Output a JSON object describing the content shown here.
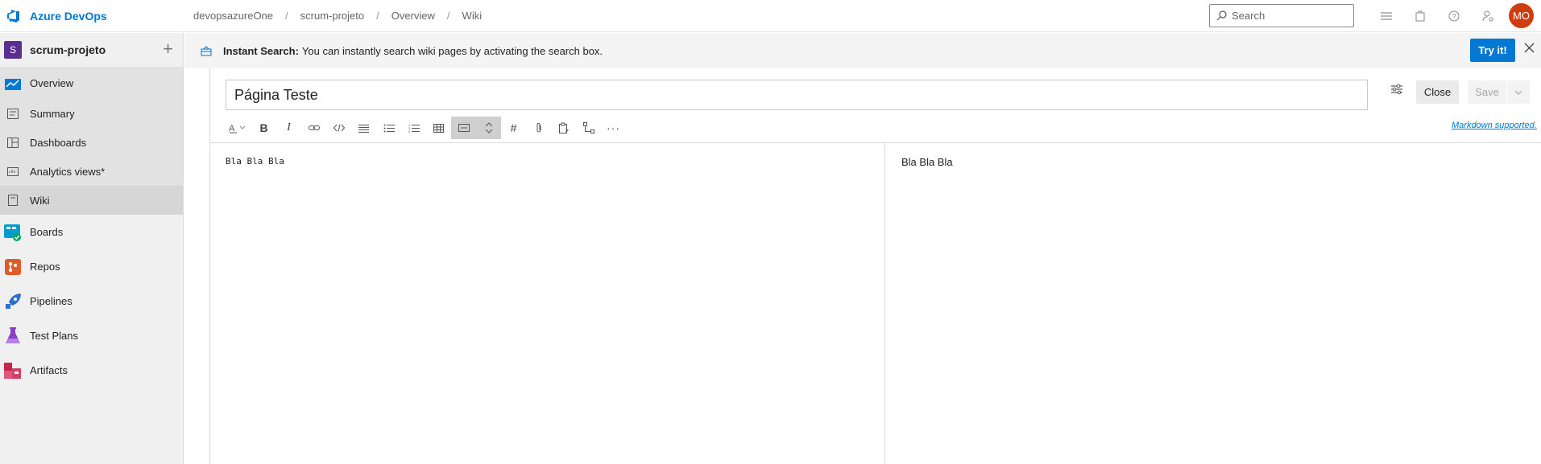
{
  "header": {
    "brand": "Azure DevOps",
    "breadcrumbs": [
      "devopsazureOne",
      "scrum-projeto",
      "Overview",
      "Wiki"
    ],
    "search_placeholder": "Search",
    "avatar_initials": "MO"
  },
  "sidebar": {
    "project_initial": "S",
    "project_name": "scrum-projeto",
    "items": [
      {
        "label": "Overview",
        "icon": "overview-icon"
      },
      {
        "label": "Summary",
        "icon": "summary-icon"
      },
      {
        "label": "Dashboards",
        "icon": "dashboards-icon"
      },
      {
        "label": "Analytics views*",
        "icon": "analytics-icon"
      },
      {
        "label": "Wiki",
        "icon": "wiki-icon"
      },
      {
        "label": "Boards",
        "icon": "boards-icon"
      },
      {
        "label": "Repos",
        "icon": "repos-icon"
      },
      {
        "label": "Pipelines",
        "icon": "pipelines-icon"
      },
      {
        "label": "Test Plans",
        "icon": "test-plans-icon"
      },
      {
        "label": "Artifacts",
        "icon": "artifacts-icon"
      }
    ]
  },
  "banner": {
    "title": "Instant Search:",
    "text": "You can instantly search wiki pages by activating the search box.",
    "button": "Try it!"
  },
  "editor": {
    "page_title": "Página Teste",
    "close_label": "Close",
    "save_label": "Save",
    "markdown_link": "Markdown supported.",
    "source_text": "Bla Bla Bla",
    "preview_text": "Bla Bla Bla"
  },
  "colors": {
    "accent": "#0078d4",
    "avatar": "#d13c0f",
    "project_badge": "#5c2d91"
  }
}
